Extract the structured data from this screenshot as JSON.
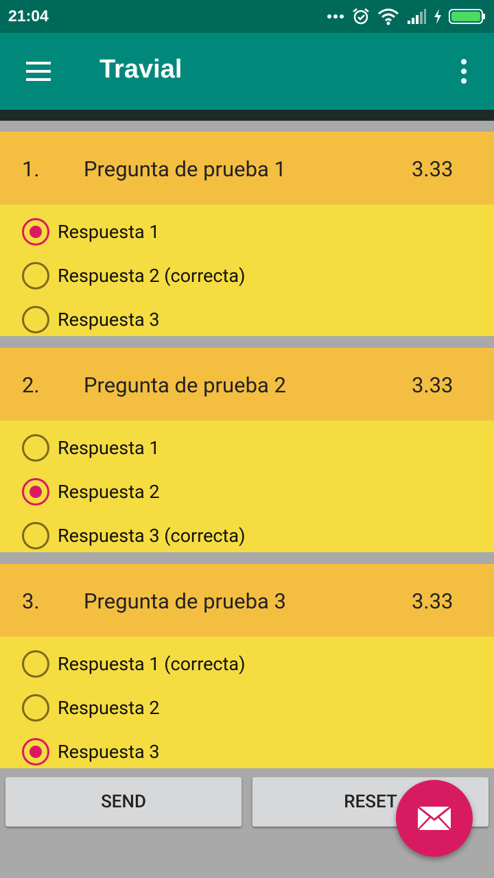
{
  "status_bar": {
    "time": "21:04"
  },
  "app_bar": {
    "title": "Travial"
  },
  "questions": [
    {
      "number": "1.",
      "text": "Pregunta de prueba 1",
      "score": "3.33",
      "options": [
        {
          "label": "Respuesta 1",
          "checked": true
        },
        {
          "label": "Respuesta 2 (correcta)",
          "checked": false
        },
        {
          "label": "Respuesta 3",
          "checked": false
        }
      ]
    },
    {
      "number": "2.",
      "text": "Pregunta de prueba 2",
      "score": "3.33",
      "options": [
        {
          "label": "Respuesta 1",
          "checked": false
        },
        {
          "label": "Respuesta 2",
          "checked": true
        },
        {
          "label": "Respuesta 3 (correcta)",
          "checked": false
        }
      ]
    },
    {
      "number": "3.",
      "text": "Pregunta de prueba 3",
      "score": "3.33",
      "options": [
        {
          "label": "Respuesta 1 (correcta)",
          "checked": false
        },
        {
          "label": "Respuesta 2",
          "checked": false
        },
        {
          "label": "Respuesta 3",
          "checked": true
        }
      ]
    }
  ],
  "buttons": {
    "send": "SEND",
    "reset": "RESET"
  },
  "fab": {
    "icon": "mail-icon"
  },
  "colors": {
    "status_bar": "#006a5a",
    "app_bar": "#00897b",
    "question_header": "#f4be41",
    "question_body": "#f5dc41",
    "accent": "#d81b60",
    "background": "#a9a9a9"
  }
}
